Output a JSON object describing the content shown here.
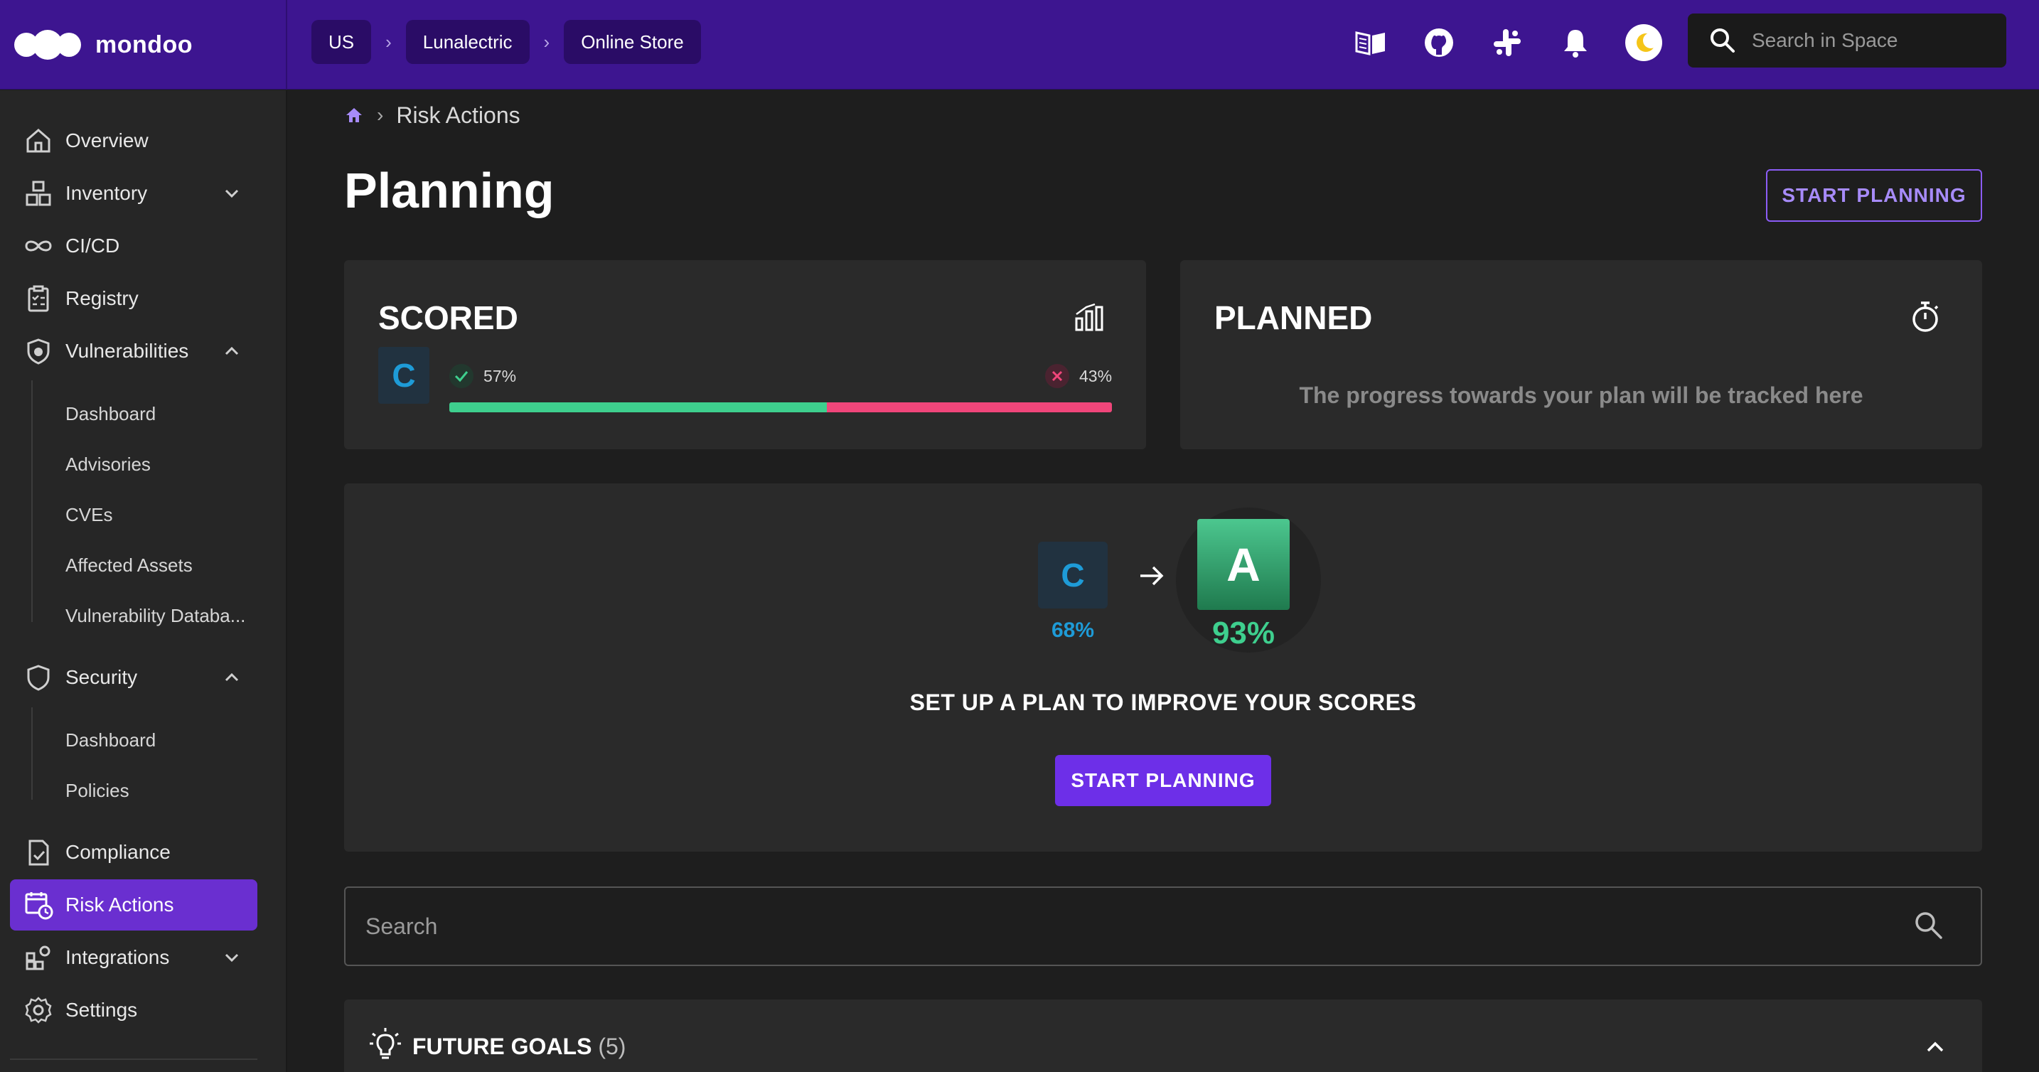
{
  "app": {
    "brand": "mondoo"
  },
  "topbar": {
    "breadcrumbs": [
      "US",
      "Lunalectric",
      "Online Store"
    ],
    "icons": [
      "docs-icon",
      "github-icon",
      "slack-icon",
      "bell-icon",
      "theme-toggle-icon"
    ],
    "search_placeholder": "Search in Space",
    "colors": {
      "bar": "#3d1590",
      "chip": "#2a0c66"
    }
  },
  "sidebar": {
    "items": [
      {
        "label": "Overview",
        "icon": "home-icon"
      },
      {
        "label": "Inventory",
        "icon": "inventory-icon"
      },
      {
        "label": "CI/CD",
        "icon": "infinity-icon"
      },
      {
        "label": "Registry",
        "icon": "clipboard-icon"
      },
      {
        "label": "Vulnerabilities",
        "icon": "shield-bug-icon"
      },
      {
        "label": "Security",
        "icon": "shield-icon"
      },
      {
        "label": "Compliance",
        "icon": "compliance-icon"
      },
      {
        "label": "Risk Actions",
        "icon": "calendar-clock-icon"
      },
      {
        "label": "Integrations",
        "icon": "integrations-icon"
      },
      {
        "label": "Settings",
        "icon": "gear-icon"
      }
    ],
    "vuln_sub": [
      "Dashboard",
      "Advisories",
      "CVEs",
      "Affected Assets",
      "Vulnerability Databa..."
    ],
    "security_sub": [
      "Dashboard",
      "Policies"
    ],
    "active": "Risk Actions",
    "accent": "#6a2fd0"
  },
  "page": {
    "breadcrumb": "Risk Actions",
    "title": "Planning",
    "start_planning": "START PLANNING"
  },
  "scored": {
    "title": "SCORED",
    "grade": "C",
    "pass_pct": "57%",
    "fail_pct": "43%",
    "pass_fraction": 0.57,
    "colors": {
      "pass": "#3ecf8e",
      "fail": "#f0467a",
      "grade": "#1e9bd7"
    }
  },
  "planned": {
    "title": "PLANNED",
    "message": "The progress towards your plan will be tracked here"
  },
  "plan": {
    "from_grade": "C",
    "from_pct": "68%",
    "to_grade": "A",
    "to_pct": "93%",
    "heading": "SET UP A PLAN TO IMPROVE YOUR SCORES",
    "button": "START PLANNING"
  },
  "search": {
    "placeholder": "Search"
  },
  "goals": {
    "title": "FUTURE GOALS",
    "count": "(5)"
  }
}
